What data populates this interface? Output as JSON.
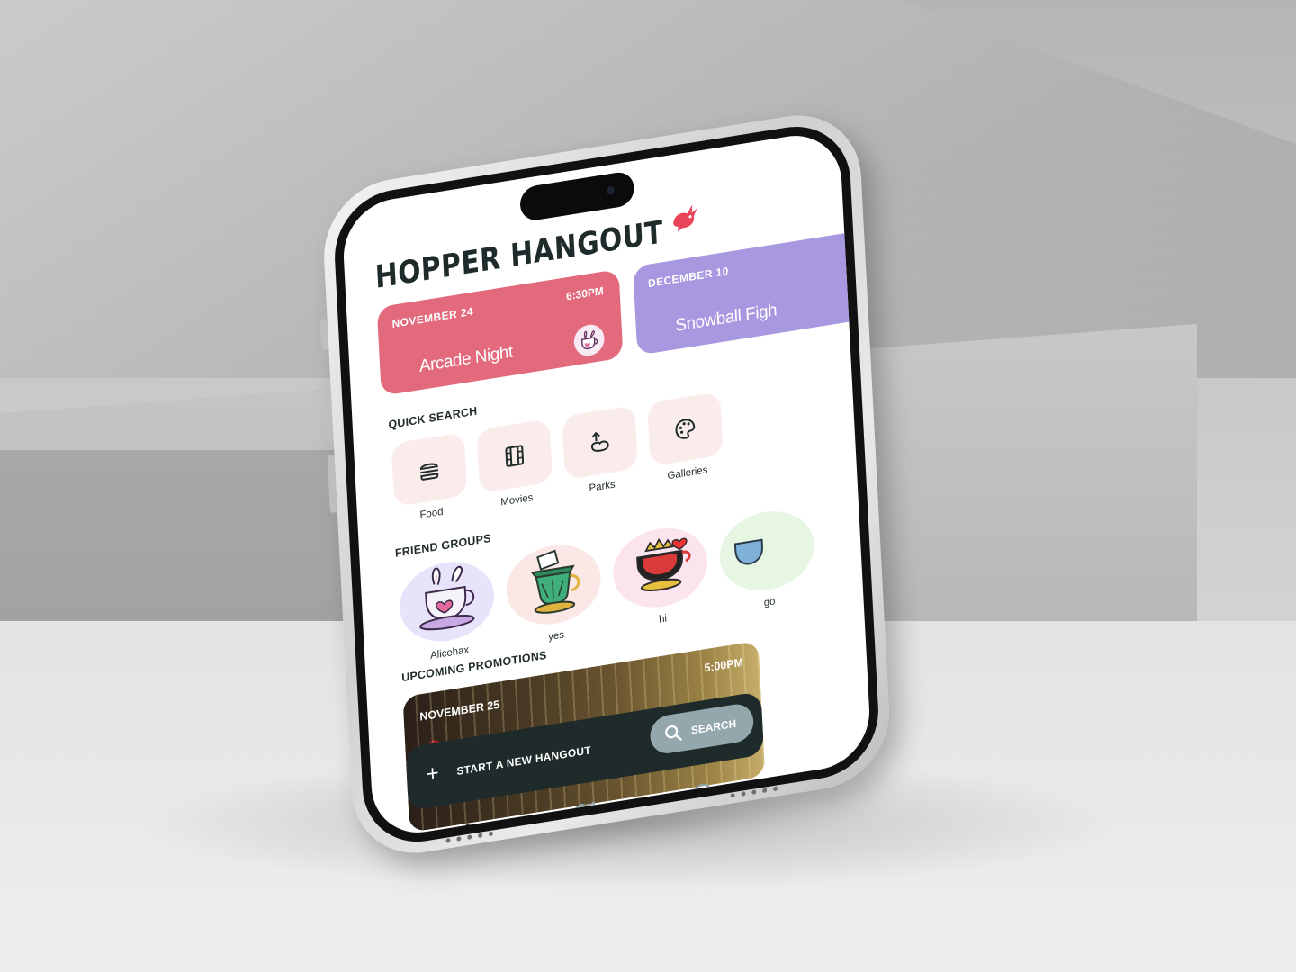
{
  "app": {
    "title": "HOPPER HANGOUT"
  },
  "events": [
    {
      "date": "NOVEMBER 24",
      "time": "6:30PM",
      "name": "Arcade Night",
      "color": "#e36a7c"
    },
    {
      "date": "DECEMBER 10",
      "time": "",
      "name": "Snowball Figh",
      "color": "#a898df"
    }
  ],
  "quick_search": {
    "label": "QUICK SEARCH",
    "items": [
      {
        "label": "Food",
        "icon": "burger-icon"
      },
      {
        "label": "Movies",
        "icon": "film-icon"
      },
      {
        "label": "Parks",
        "icon": "park-icon"
      },
      {
        "label": "Galleries",
        "icon": "palette-icon"
      }
    ]
  },
  "friend_groups": {
    "label": "FRIEND GROUPS",
    "items": [
      {
        "label": "Alicehax",
        "icon": "bunny-teacup-icon",
        "color": "#e6e3fb"
      },
      {
        "label": "yes",
        "icon": "hatter-teacup-icon",
        "color": "#fbe8e6"
      },
      {
        "label": "hi",
        "icon": "queen-teacup-icon",
        "color": "#fbe4ee"
      },
      {
        "label": "go",
        "icon": "teacup-icon",
        "color": "#e6f6e2"
      }
    ]
  },
  "promotions": {
    "label": "UPCOMING PROMOTIONS",
    "items": [
      {
        "date": "NOVEMBER 25",
        "time": "5:00PM"
      }
    ]
  },
  "actions": {
    "new_hangout": "START A NEW HANGOUT",
    "search": "SEARCH"
  },
  "nav": [
    "home-icon",
    "map-icon",
    "profile-icon"
  ],
  "colors": {
    "dark": "#1f2b2a",
    "pink": "#e36a7c",
    "purple": "#a898df",
    "search": "#93a7ad",
    "tile": "#fbecec"
  }
}
